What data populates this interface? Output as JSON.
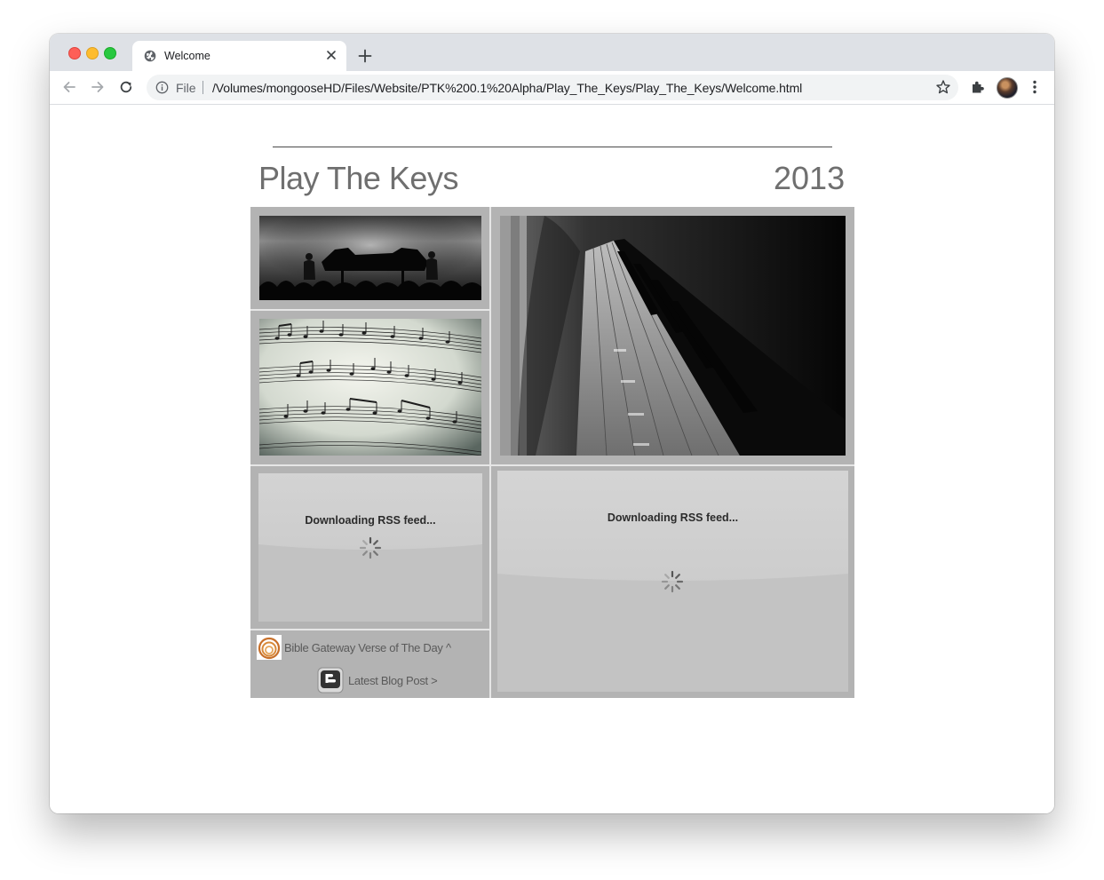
{
  "browser": {
    "tab": {
      "title": "Welcome"
    },
    "address_bar": {
      "scheme_label": "File",
      "url": "/Volumes/mongooseHD/Files/Website/PTK%200.1%20Alpha/Play_The_Keys/Play_The_Keys/Welcome.html"
    }
  },
  "page": {
    "title": "Play The Keys",
    "year": "2013",
    "rss_feeds": [
      {
        "status": "Downloading RSS feed..."
      },
      {
        "status": "Downloading RSS feed..."
      }
    ],
    "links": {
      "verse": "Bible Gateway Verse of The Day ^",
      "blog": "Latest Blog Post >"
    }
  },
  "colors": {
    "tabstrip": "#dee1e6",
    "grid_background": "#b3b3b3",
    "title_text": "#6f6f6f",
    "rss_panel": "#c9c9c9"
  }
}
